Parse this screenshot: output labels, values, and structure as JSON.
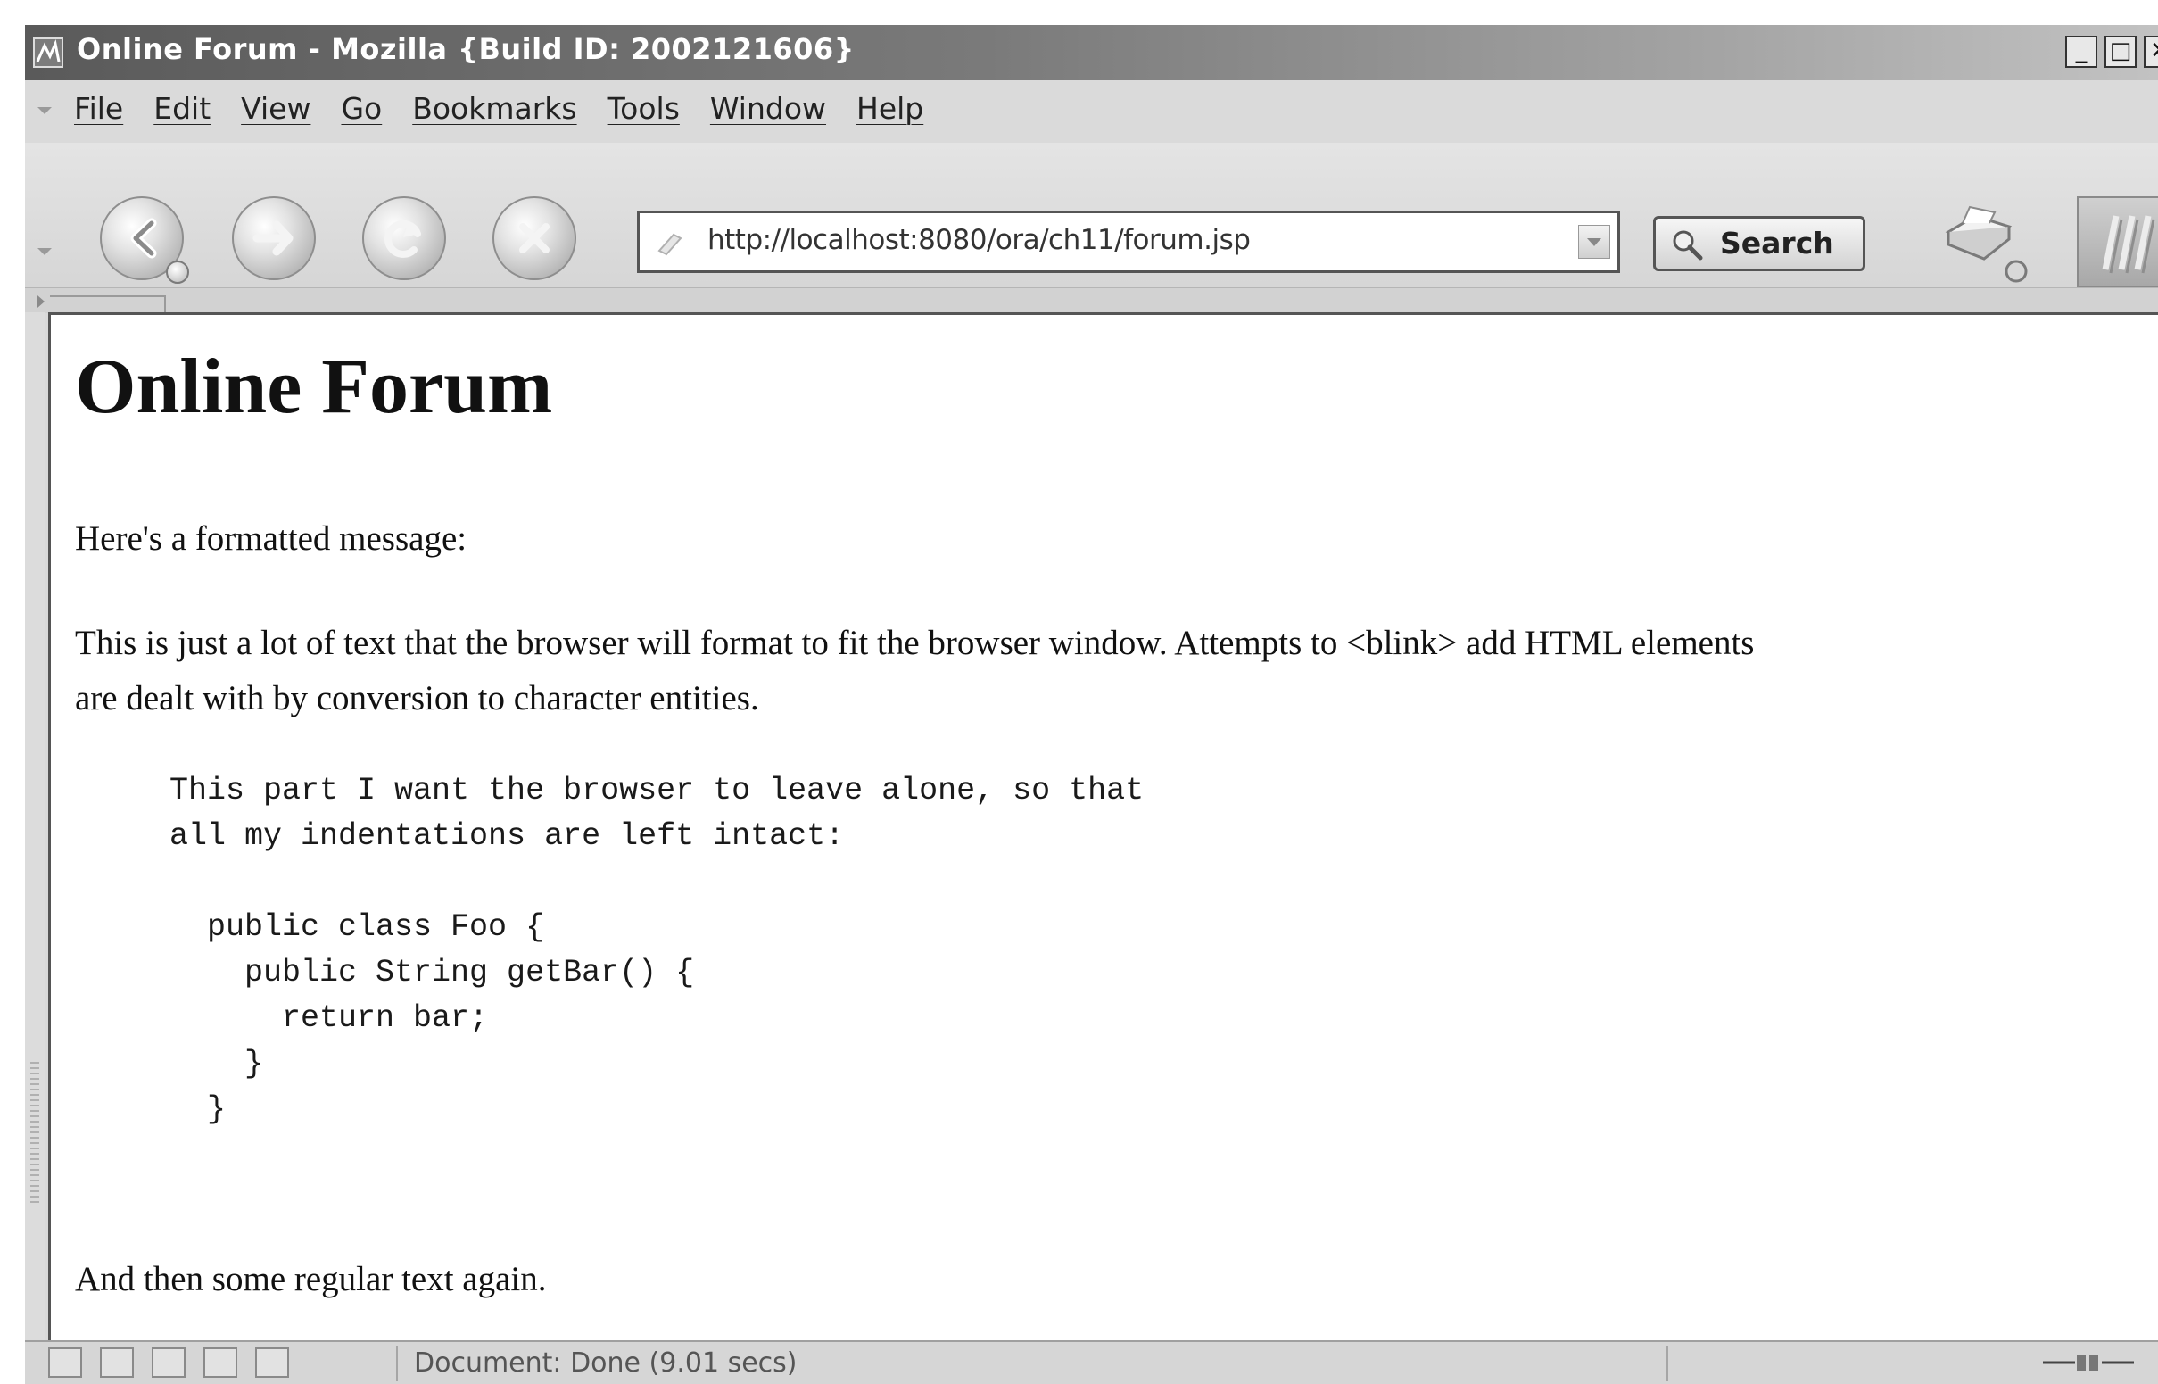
{
  "window": {
    "title": "Online Forum - Mozilla {Build ID: 2002121606}",
    "controls": [
      "_",
      "□",
      "✕"
    ]
  },
  "menu": {
    "items": [
      "File",
      "Edit",
      "View",
      "Go",
      "Bookmarks",
      "Tools",
      "Window",
      "Help"
    ]
  },
  "toolbar": {
    "back_icon": "back-arrow-icon",
    "forward_icon": "forward-arrow-icon",
    "reload_icon": "reload-icon",
    "stop_icon": "stop-icon",
    "url": "http://localhost:8080/ora/ch11/forum.jsp",
    "search_label": "Search"
  },
  "page": {
    "heading": "Online Forum",
    "intro": "Here's a formatted message:",
    "body_line1": "This is just a lot of text that the browser will format to fit the browser window. Attempts to <blink> add HTML elements",
    "body_line2": "are dealt with by conversion to character entities.",
    "preformatted": "This part I want the browser to leave alone, so that\nall my indentations are left intact:\n\n  public class Foo {\n    public String getBar() {\n      return bar;\n    }\n  }",
    "closing": "And then some regular text again."
  },
  "status": {
    "text": "Document: Done (9.01 secs)"
  },
  "colors": {
    "titlebar_dark": "#5a5a5a",
    "chrome": "#d9d9d9",
    "content_bg": "#ffffff"
  }
}
